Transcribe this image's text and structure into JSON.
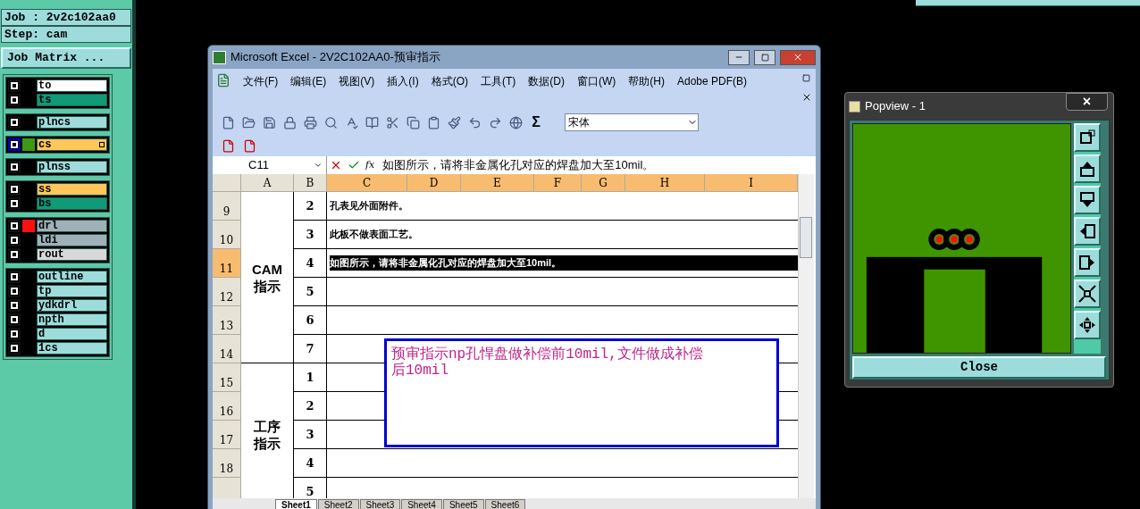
{
  "job_panel": {
    "job": "Job : 2v2c102aa0",
    "step": "Step: cam",
    "matrix_button": "Job Matrix ...",
    "layer_groups": [
      {
        "layers": [
          {
            "name": "to",
            "color": "#ffffff",
            "selected": false
          },
          {
            "name": "ts",
            "color": "#0f9a78",
            "selected": false
          }
        ]
      },
      {
        "layers": [
          {
            "name": "plncs",
            "color": "#9edcdc",
            "selected": false
          }
        ]
      },
      {
        "layers": [
          {
            "name": "cs",
            "color": "#ffc65a",
            "selected": true,
            "swatch": {
              "color": "#3d9a10"
            },
            "expandable": true
          }
        ]
      },
      {
        "layers": [
          {
            "name": "plnss",
            "color": "#9edcdc",
            "selected": false
          }
        ]
      },
      {
        "layers": [
          {
            "name": "ss",
            "color": "#ffc65a",
            "selected": false
          },
          {
            "name": "bs",
            "color": "#0f9a78",
            "selected": false
          }
        ]
      },
      {
        "layers": [
          {
            "name": "drl",
            "color": "#9fb0b8",
            "selected": false,
            "swatch": {
              "color": "#ff1010"
            }
          },
          {
            "name": "ldi",
            "color": "#9fb0b8",
            "selected": false
          },
          {
            "name": "rout",
            "color": "#d8d8d8",
            "selected": false
          }
        ]
      },
      {
        "layers": [
          {
            "name": "outline",
            "color": "#9edcdc",
            "selected": false
          },
          {
            "name": "tp",
            "color": "#9edcdc",
            "selected": false
          },
          {
            "name": "ydkdrl",
            "color": "#9edcdc",
            "selected": false
          },
          {
            "name": "npth",
            "color": "#9edcdc",
            "selected": false
          },
          {
            "name": "d",
            "color": "#9edcdc",
            "selected": false
          },
          {
            "name": "1cs",
            "color": "#9edcdc",
            "selected": false
          }
        ]
      }
    ]
  },
  "excel": {
    "title": "Microsoft Excel - 2V2C102AA0-预审指示",
    "menus": [
      "文件(F)",
      "编辑(E)",
      "视图(V)",
      "插入(I)",
      "格式(O)",
      "工具(T)",
      "数据(D)",
      "窗口(W)",
      "帮助(H)",
      "Adobe PDF(B)"
    ],
    "sum_glyph": "Σ",
    "font_name": "宋体",
    "function_glyph": "fx",
    "name_box": "C11",
    "formula": "如图所示，请将非金属化孔对应的焊盘加大至10mil。",
    "columns": [
      {
        "label": "A",
        "selected": false
      },
      {
        "label": "B",
        "selected": false
      },
      {
        "label": "C",
        "selected": true
      },
      {
        "label": "D",
        "selected": true
      },
      {
        "label": "E",
        "selected": true
      },
      {
        "label": "F",
        "selected": true
      },
      {
        "label": "G",
        "selected": true
      },
      {
        "label": "H",
        "selected": true
      },
      {
        "label": "I",
        "selected": true
      }
    ],
    "sections": [
      {
        "title_lines": [
          "CAM",
          "指示"
        ],
        "rows": [
          {
            "label": "9",
            "b": "2",
            "c": "孔表见外面附件。",
            "selected": false
          },
          {
            "label": "10",
            "b": "3",
            "c": "此板不做表面工艺。",
            "selected": false
          },
          {
            "label": "11",
            "b": "4",
            "c": "如图所示，请将非金属化孔对应的焊盘加大至10mil。",
            "selected": true
          },
          {
            "label": "12",
            "b": "5",
            "selected": false
          },
          {
            "label": "13",
            "b": "6",
            "selected": false
          },
          {
            "label": "14",
            "b": "7",
            "selected": false
          }
        ]
      },
      {
        "title_lines": [
          "工序",
          "指示"
        ],
        "rows": [
          {
            "label": "15",
            "b": "1",
            "selected": false
          },
          {
            "label": "16",
            "b": "2",
            "selected": false
          },
          {
            "label": "17",
            "b": "3",
            "selected": false
          },
          {
            "label": "18",
            "b": "4",
            "selected": false
          },
          {
            "b": "5",
            "selected": false
          }
        ]
      }
    ],
    "note": "预审指示np孔悍盘做补偿前10mil,文件做成补偿后10mil",
    "sheets": [
      {
        "label": "Sheet1",
        "selected": true
      },
      {
        "label": "Sheet2",
        "selected": false
      },
      {
        "label": "Sheet3",
        "selected": false
      },
      {
        "label": "Sheet4",
        "selected": false
      },
      {
        "label": "Sheet5",
        "selected": false
      },
      {
        "label": "Sheet6",
        "selected": false
      }
    ]
  },
  "popview": {
    "title": "Popview - 1",
    "close_glyph": "×",
    "close_button": "Close"
  }
}
